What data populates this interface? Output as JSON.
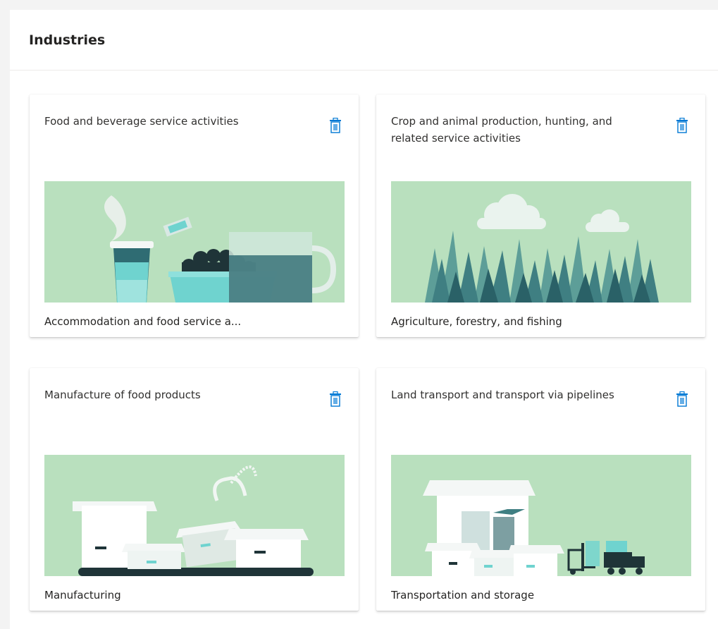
{
  "page": {
    "title": "Industries"
  },
  "cards": [
    {
      "title": "Food and beverage service activities",
      "label": "Accommodation and food service a...",
      "illustration": "food-beverage-illustration",
      "icon": "trash-icon"
    },
    {
      "title": "Crop and animal production, hunting, and related service activities",
      "label": "Agriculture, forestry, and fishing",
      "illustration": "agriculture-illustration",
      "icon": "trash-icon"
    },
    {
      "title": "Manufacture of food products",
      "label": "Manufacturing",
      "illustration": "manufacturing-illustration",
      "icon": "trash-icon"
    },
    {
      "title": "Land transport and transport via pipelines",
      "label": "Transportation and storage",
      "illustration": "transportation-illustration",
      "icon": "trash-icon"
    }
  ],
  "colors": {
    "illustration_bg": "#b9e0be",
    "accent": "#0078d4",
    "teal_dark": "#2f6c73",
    "teal_light": "#6fd3cf"
  }
}
